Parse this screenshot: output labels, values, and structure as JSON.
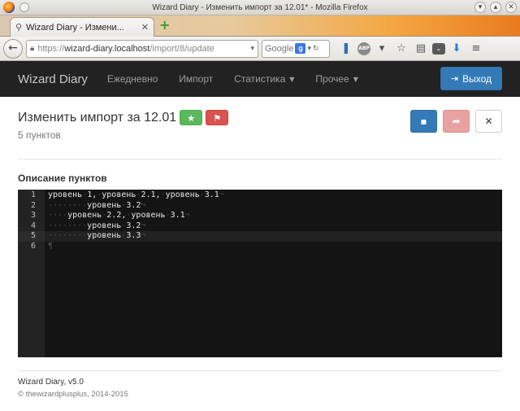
{
  "window": {
    "title": "Wizard Diary - Изменить импорт за 12.01* - Mozilla Firefox"
  },
  "tab": {
    "label": "Wizard Diary - Измени..."
  },
  "browser": {
    "url_scheme": "https://",
    "url_host": "wizard-diary.localhost",
    "url_path": "/import/8/update",
    "search_placeholder": "Google"
  },
  "nav": {
    "brand": "Wizard Diary",
    "items": [
      {
        "label": "Ежедневно"
      },
      {
        "label": "Импорт"
      },
      {
        "label": "Статистика"
      },
      {
        "label": "Прочее"
      }
    ],
    "logout_label": "Выход"
  },
  "page": {
    "title": "Изменить импорт за 12.01",
    "subtitle": "5 пунктов",
    "section_label": "Описание пунктов"
  },
  "editor": {
    "lines": [
      {
        "num": "1",
        "indent": "",
        "text": "уровень 1, уровень 2.1, уровень 3.1",
        "eol": "¬"
      },
      {
        "num": "2",
        "indent": "········",
        "text": "уровень 3.2",
        "eol": "¬"
      },
      {
        "num": "3",
        "indent": "····",
        "text": "уровень 2.2, уровень 3.1",
        "eol": "¬"
      },
      {
        "num": "4",
        "indent": "········",
        "text": "уровень 3.2",
        "eol": "¬"
      },
      {
        "num": "5",
        "indent": "········",
        "text": "уровень 3.3",
        "eol": "¬"
      },
      {
        "num": "6",
        "indent": "",
        "text": "",
        "eol": "¶"
      }
    ],
    "active_line": 5
  },
  "footer": {
    "version": "Wizard Diary, v5.0",
    "copyright": "© thewizardplusplus, 2014-2015"
  },
  "colors": {
    "navbar_bg": "#222222",
    "primary": "#337ab7",
    "success": "#5cb85c",
    "danger": "#d9534f",
    "editor_bg": "#141414"
  }
}
